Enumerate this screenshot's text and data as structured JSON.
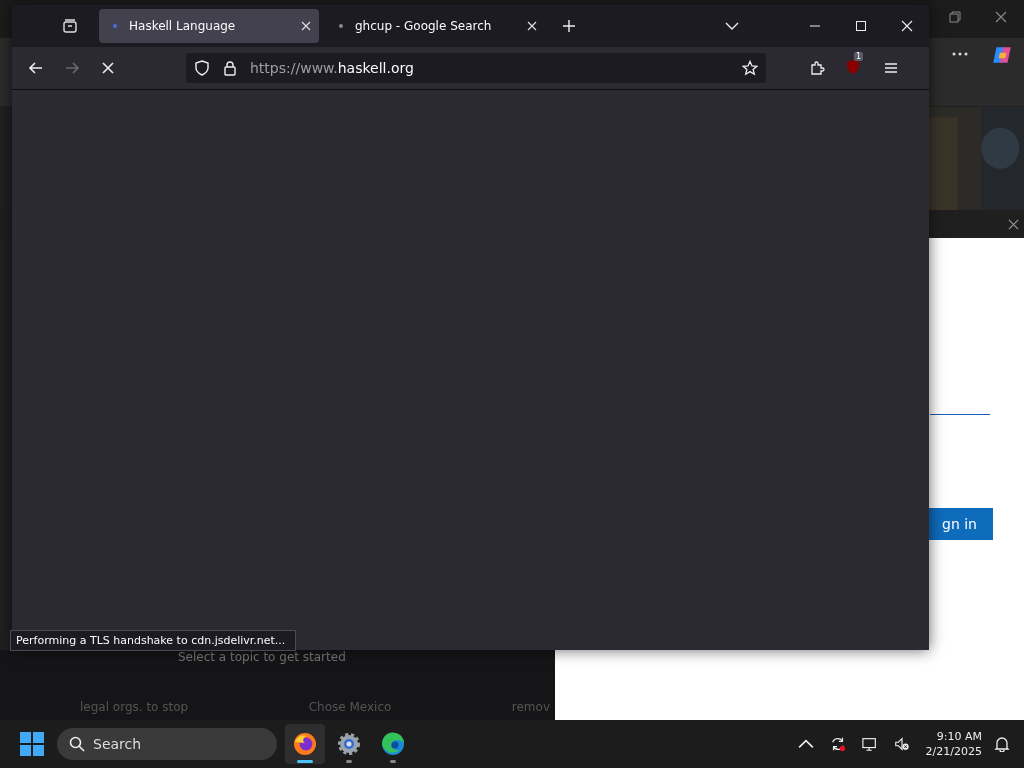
{
  "browser": {
    "tabs": [
      {
        "title": "Haskell Language",
        "selected": true
      },
      {
        "title": "ghcup - Google Search",
        "selected": false
      }
    ],
    "url": {
      "prefix": "https://www.",
      "domain": "haskell.org"
    },
    "loading": true,
    "forward_disabled": true,
    "extension_badge": "1",
    "status": "Performing a TLS handshake to cdn.jsdelivr.net..."
  },
  "background_window": {
    "sign_in_button": "gn in",
    "topic_prompt": "Select a topic to get started",
    "captions": [
      "legal orgs. to stop",
      "Chose Mexico",
      "remov"
    ]
  },
  "taskbar": {
    "search": {
      "placeholder": "Search"
    },
    "apps": [
      {
        "kind": "firefox",
        "selected": true
      },
      {
        "kind": "settings",
        "selected": false
      },
      {
        "kind": "edge",
        "selected": false
      }
    ],
    "time": "9:10 AM",
    "date": "2/21/2025"
  }
}
